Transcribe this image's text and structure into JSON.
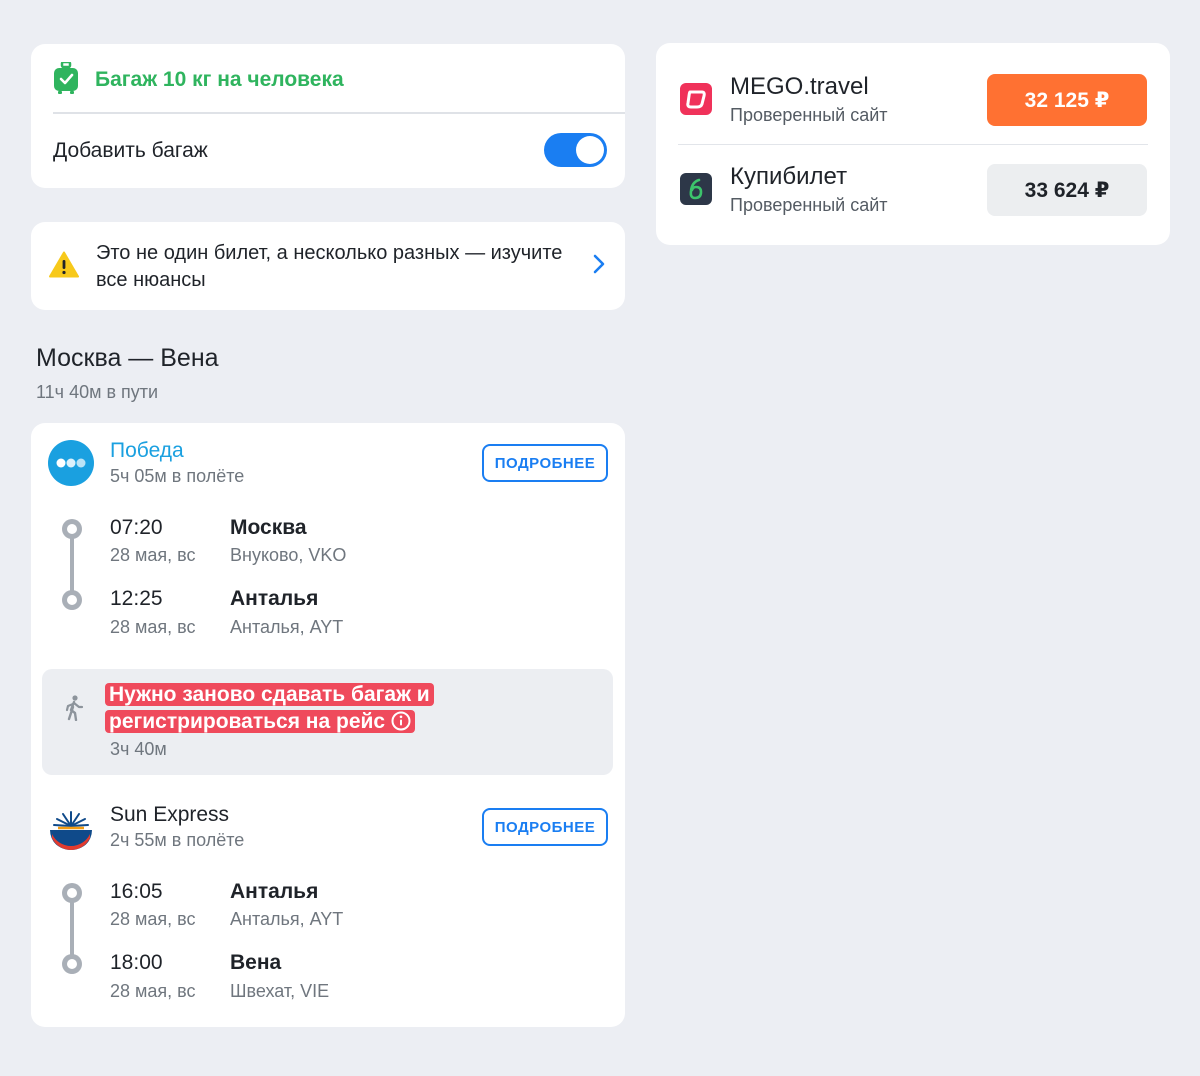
{
  "baggage": {
    "included_label": "Багаж 10 кг на человека",
    "add_label": "Добавить багаж",
    "add_enabled": true
  },
  "warning": {
    "text": "Это не один билет, а несколько разных — изучите все нюансы"
  },
  "route": {
    "title": "Москва — Вена",
    "duration": "11ч 40м в пути"
  },
  "flights": [
    {
      "airline": "Победа",
      "airline_color": "#1aa0e0",
      "flight_time": "5ч 05м в полёте",
      "details_label": "ПОДРОБНЕЕ",
      "departure": {
        "time": "07:20",
        "date": "28 мая, вс",
        "city": "Москва",
        "airport": "Внуково, VKO"
      },
      "arrival": {
        "time": "12:25",
        "date": "28 мая, вс",
        "city": "Анталья",
        "airport": "Анталья, AYT"
      }
    },
    {
      "airline": "Sun Express",
      "airline_color": "#1f2329",
      "flight_time": "2ч 55м в полёте",
      "details_label": "ПОДРОБНЕЕ",
      "departure": {
        "time": "16:05",
        "date": "28 мая, вс",
        "city": "Анталья",
        "airport": "Анталья, AYT"
      },
      "arrival": {
        "time": "18:00",
        "date": "28 мая, вс",
        "city": "Вена",
        "airport": "Швехат, VIE"
      }
    }
  ],
  "transfer": {
    "warning_line1": "Нужно заново сдавать багаж и",
    "warning_line2": "регистрироваться на рейс",
    "duration": "3ч 40м"
  },
  "offers": [
    {
      "name": "MEGO.travel",
      "subtitle": "Проверенный сайт",
      "price": "32 125 ₽",
      "highlighted": true,
      "price_bg": "#ff7132",
      "logo_color": "#f0325a"
    },
    {
      "name": "Купибилет",
      "subtitle": "Проверенный сайт",
      "price": "33 624 ₽",
      "highlighted": false,
      "price_bg": "#eceef0",
      "logo_color": "#2d3748"
    }
  ],
  "colors": {
    "accent_blue": "#1a7ef2",
    "success_green": "#2fb45e",
    "danger_red": "#ef4a5c",
    "warning_yellow": "#f7c91b"
  }
}
